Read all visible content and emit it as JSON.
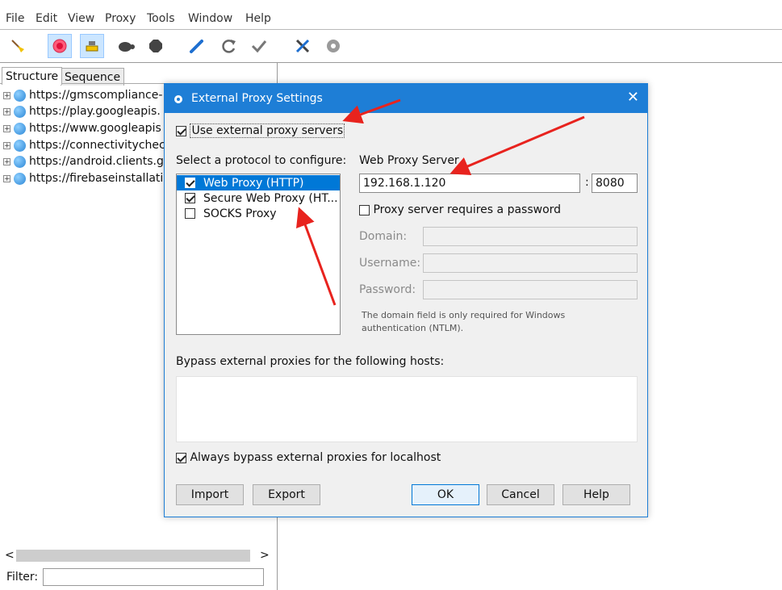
{
  "menu": [
    "File",
    "Edit",
    "View",
    "Proxy",
    "Tools",
    "Window",
    "Help"
  ],
  "toolbar": {
    "items": [
      {
        "name": "broom-icon"
      },
      {
        "name": "record-icon"
      },
      {
        "name": "throttle-icon"
      },
      {
        "name": "turtle-icon"
      },
      {
        "name": "stop-icon"
      },
      {
        "name": "pen-icon"
      },
      {
        "name": "refresh-icon"
      },
      {
        "name": "checkmark-icon"
      },
      {
        "name": "tools-icon"
      },
      {
        "name": "settings-gear-icon"
      }
    ]
  },
  "left_pane": {
    "tabs": [
      "Structure",
      "Sequence"
    ],
    "tree": [
      "https://gmscompliance-",
      "https://play.googleapis.",
      "https://www.googleapis",
      "https://connectivitychec",
      "https://android.clients.g",
      "https://firebaseinstallati"
    ],
    "scroll_left": "<",
    "scroll_right": ">",
    "filter_label": "Filter:",
    "filter_value": ""
  },
  "dialog": {
    "title": "External Proxy Settings",
    "close": "✕",
    "use_external": "Use external proxy servers",
    "protocol_label": "Select a protocol to configure:",
    "protocols": [
      {
        "label": "Web Proxy (HTTP)",
        "checked": true,
        "selected": true
      },
      {
        "label": "Secure Web Proxy (HT...",
        "checked": true,
        "selected": false
      },
      {
        "label": "SOCKS Proxy",
        "checked": false,
        "selected": false
      }
    ],
    "web_proxy_server_label": "Web Proxy Server",
    "host": "192.168.1.120",
    "colon": ":",
    "port": "8080",
    "requires_password": "Proxy server requires a password",
    "domain_label": "Domain:",
    "username_label": "Username:",
    "password_label": "Password:",
    "note_line1": "The domain field is only required for Windows",
    "note_line2": "authentication (NTLM).",
    "bypass_label": "Bypass external proxies for the following hosts:",
    "bypass_value": "",
    "always_bypass": "Always bypass external proxies for localhost",
    "buttons": {
      "import": "Import",
      "export": "Export",
      "ok": "OK",
      "cancel": "Cancel",
      "help": "Help"
    }
  },
  "colors": {
    "accent": "#1e7ed6",
    "selection": "#0078d7",
    "annotation_arrow": "#e8231e"
  }
}
